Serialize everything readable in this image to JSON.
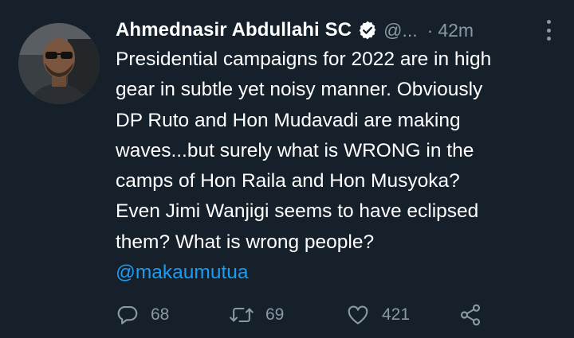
{
  "tweet": {
    "author_name": "Ahmednasir Abdullahi SC",
    "handle": "@...",
    "separator": "·",
    "time": "42m",
    "lines": [
      "Presidential campaigns for 2022 are in high",
      "gear in subtle yet noisy manner. Obviously",
      "DP Ruto and Hon Mudavadi are making",
      "waves...but surely what is WRONG in the",
      "camps of Hon Raila and Hon Musyoka?",
      "Even Jimi Wanjigi seems to have eclipsed",
      "them? What is wrong people?"
    ],
    "mention": "@makaumutua"
  },
  "actions": {
    "reply_count": "68",
    "retweet_count": "69",
    "like_count": "421"
  },
  "icons": {
    "verified": "verified-badge-icon",
    "more": "more-options-icon",
    "reply": "reply-icon",
    "retweet": "retweet-icon",
    "like": "heart-icon",
    "share": "share-icon"
  },
  "colors": {
    "background": "#15202b",
    "text": "#ffffff",
    "muted": "#8b98a5",
    "link": "#1d9bf0"
  }
}
